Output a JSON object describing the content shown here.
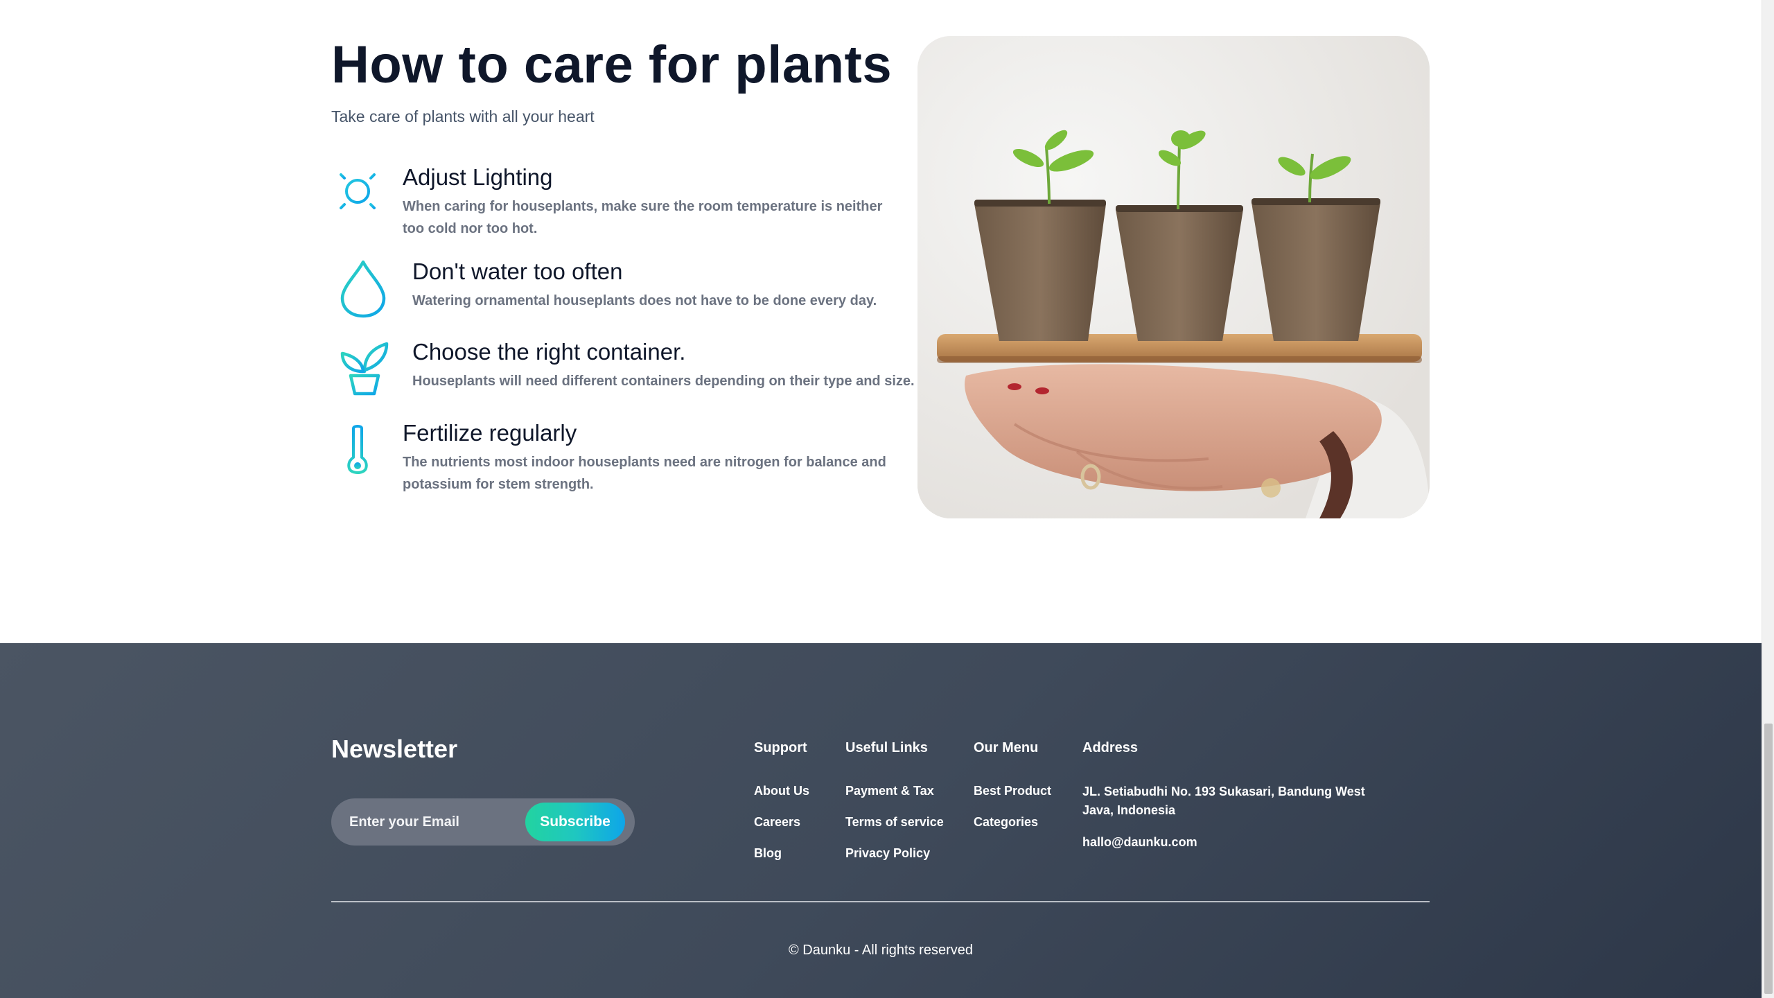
{
  "care": {
    "title": "How to care for plants",
    "subtitle": "Take care of plants with all your heart",
    "tips": [
      {
        "icon": "sun-icon",
        "title": "Adjust Lighting",
        "text": "When caring for houseplants, make sure the room temperature is neither too cold nor too hot."
      },
      {
        "icon": "water-drop-icon",
        "title": "Don't water too often",
        "text": "Watering ornamental houseplants does not have to be done every day."
      },
      {
        "icon": "plant-pot-icon",
        "title": "Choose the right container.",
        "text": "Houseplants will need different containers depending on their type and size."
      },
      {
        "icon": "thermometer-icon",
        "title": "Fertilize regularly",
        "text": "The nutrients most indoor houseplants need are nitrogen for balance and potassium for stem strength."
      }
    ],
    "accent_gradient": [
      "#14b8a6",
      "#0ea5e9"
    ]
  },
  "footer": {
    "newsletter_title": "Newsletter",
    "email_placeholder": "Enter your Email",
    "subscribe_label": "Subscribe",
    "columns": [
      {
        "title": "Support",
        "links": [
          "About Us",
          "Careers",
          "Blog"
        ]
      },
      {
        "title": "Useful Links",
        "links": [
          "Payment & Tax",
          "Terms of service",
          "Privacy Policy"
        ]
      },
      {
        "title": "Our Menu",
        "links": [
          "Best Product",
          "Categories"
        ]
      }
    ],
    "address_title": "Address",
    "address": "JL. Setiabudhi No. 193 Sukasari, Bandung West Java, Indonesia",
    "email": "hallo@daunku.com",
    "copyright": "© Daunku - All rights reserved",
    "background_colors": [
      "#4b5563",
      "#2d3748"
    ]
  }
}
